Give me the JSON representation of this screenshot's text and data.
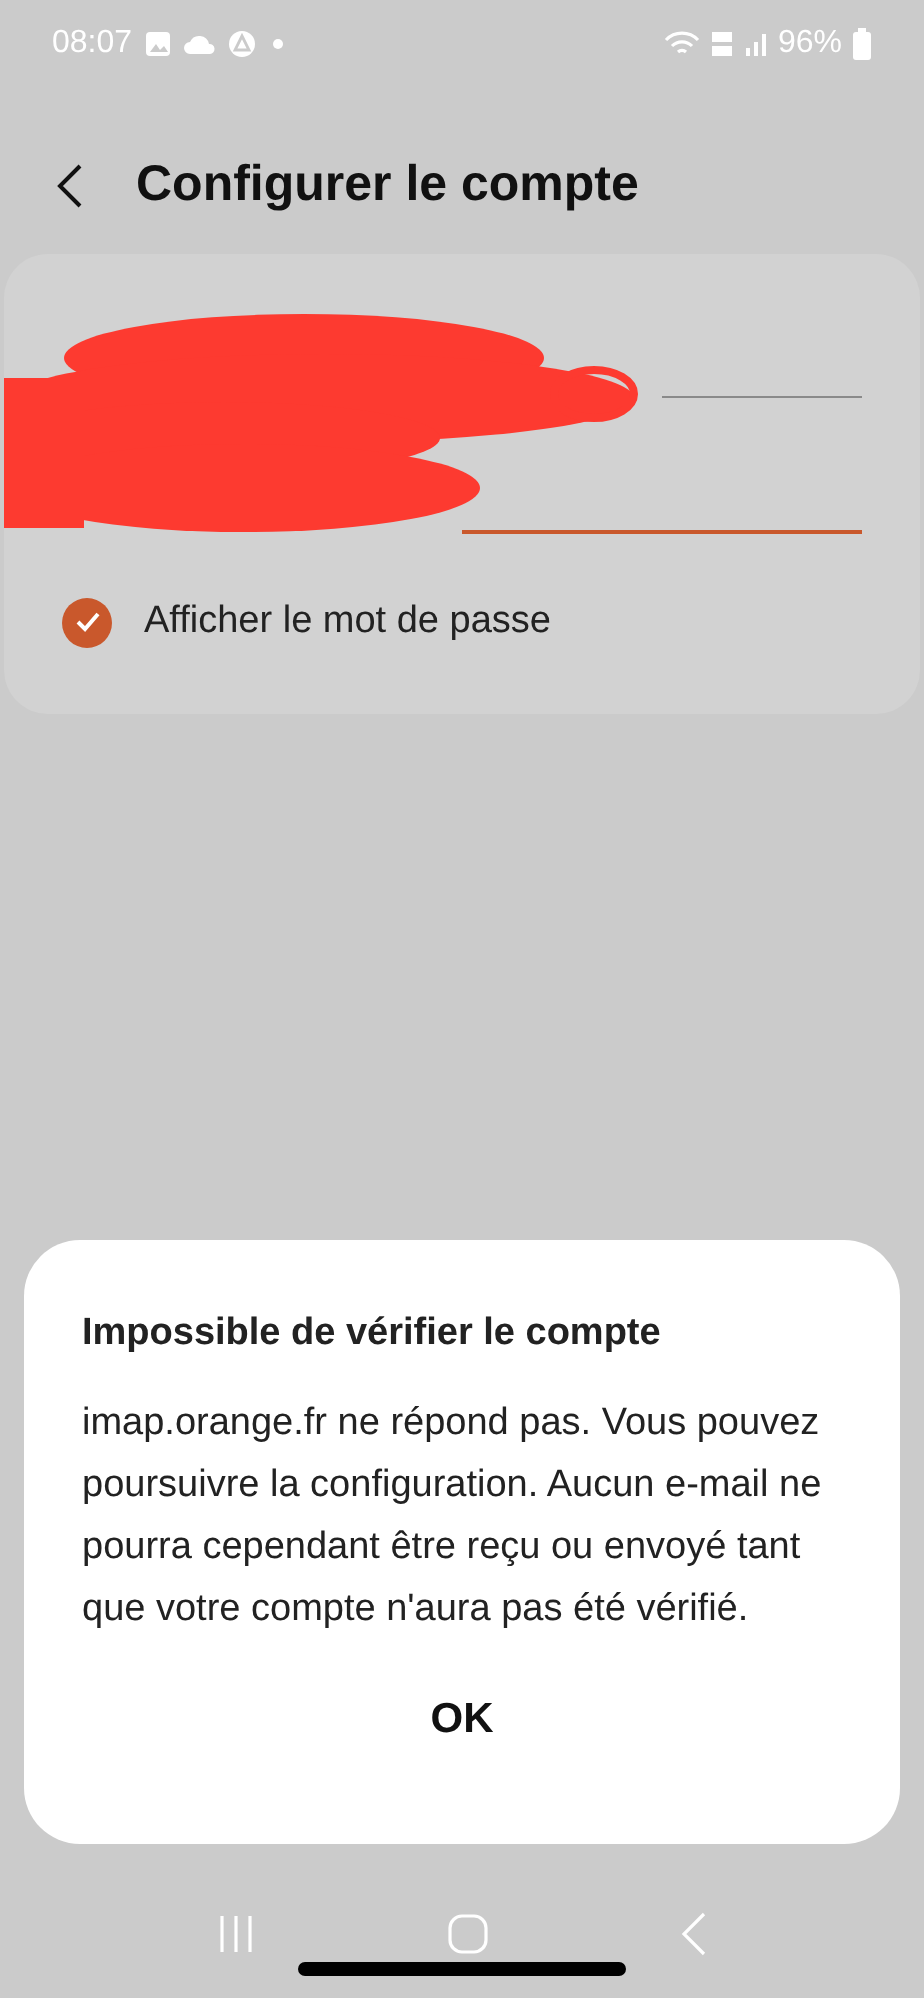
{
  "status_bar": {
    "time": "08:07",
    "battery": "96%"
  },
  "header": {
    "title": "Configurer le compte"
  },
  "fields": [
    {
      "focused": false
    },
    {
      "focused": true
    }
  ],
  "show_password": {
    "label": "Afficher le mot de passe",
    "checked": true
  },
  "dialog": {
    "title": "Impossible de vérifier le compte",
    "message": "imap.orange.fr ne répond pas. Vous pouvez poursuivre la configuration. Aucun e-mail ne pourra cependant être reçu ou envoyé tant que votre compte n'aura pas été vérifié.",
    "button": "OK"
  }
}
